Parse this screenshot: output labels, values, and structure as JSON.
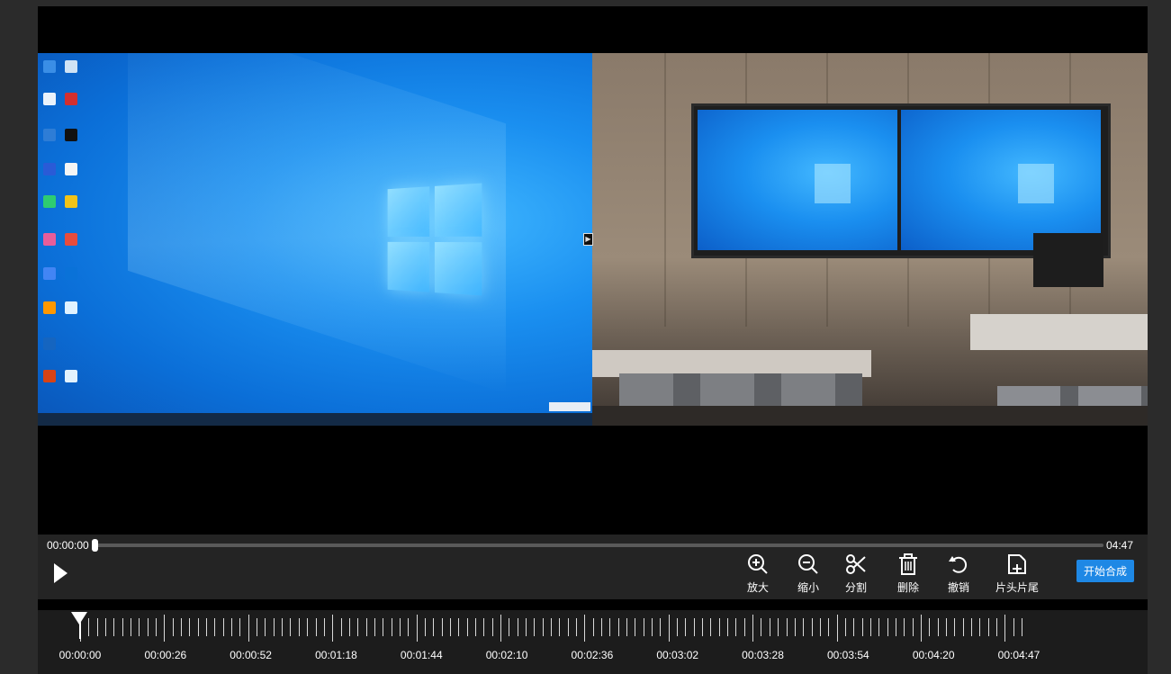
{
  "player": {
    "time_current": "00:00:00",
    "time_total": "04:47",
    "progress_fraction": 0.0
  },
  "toolbar": [
    {
      "name": "zoom-in-button",
      "icon": "zoom-in-icon",
      "label": "放大"
    },
    {
      "name": "zoom-out-button",
      "icon": "zoom-out-icon",
      "label": "缩小"
    },
    {
      "name": "split-button",
      "icon": "scissors-icon",
      "label": "分割"
    },
    {
      "name": "delete-button",
      "icon": "trash-icon",
      "label": "删除"
    },
    {
      "name": "undo-button",
      "icon": "undo-icon",
      "label": "撤销"
    },
    {
      "name": "intro-outro-button",
      "icon": "add-clip-icon",
      "label": "片头片尾"
    }
  ],
  "merge_button": {
    "label": "开始合成",
    "color": "#1e88e5"
  },
  "timeline": {
    "labels": [
      "00:00:00",
      "00:00:26",
      "00:00:52",
      "00:01:18",
      "00:01:44",
      "00:02:10",
      "00:02:36",
      "00:03:02",
      "00:03:28",
      "00:03:54",
      "00:04:20",
      "00:04:47"
    ],
    "playhead_time": "00:00:00"
  },
  "colors": {
    "background": "#2b2b2b",
    "video_bg": "#000000",
    "accent": "#1e88e5"
  }
}
